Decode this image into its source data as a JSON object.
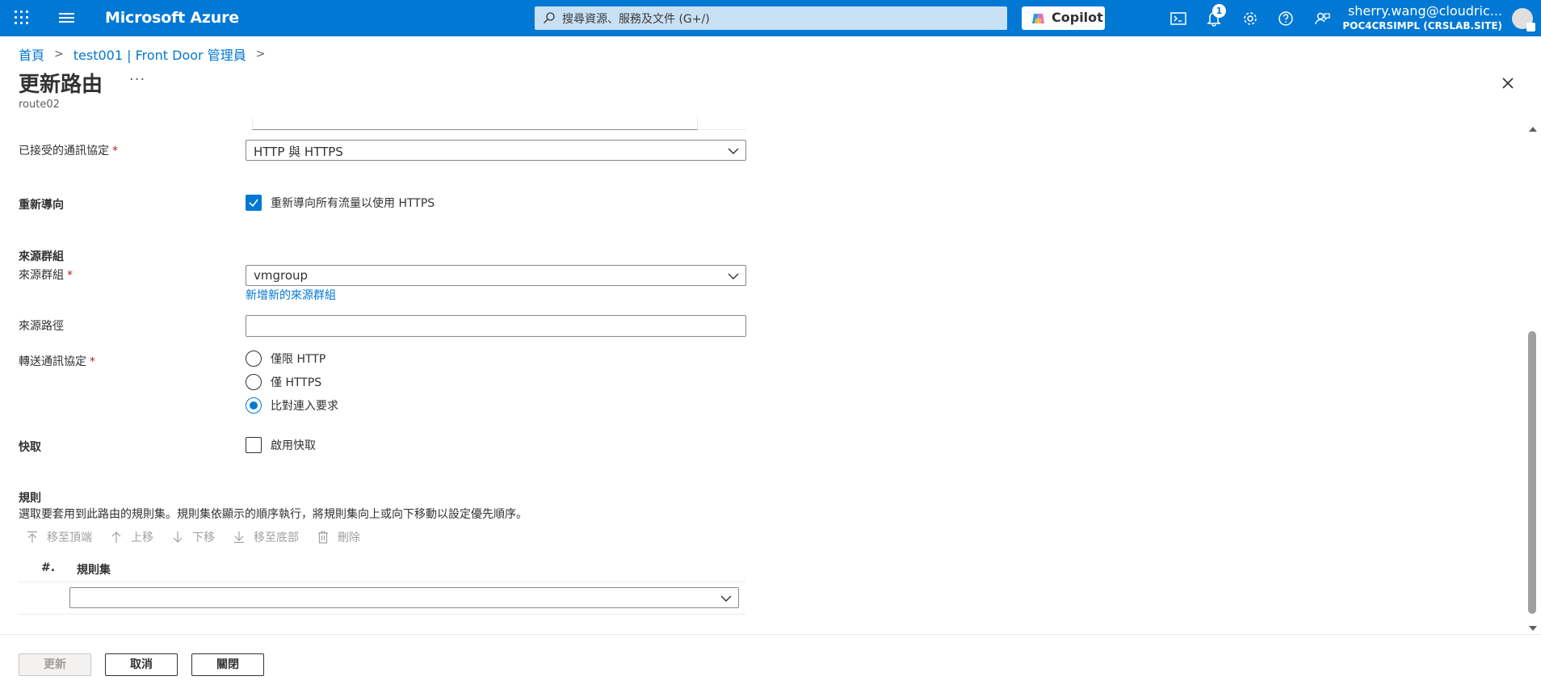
{
  "topbar": {
    "brand": "Microsoft Azure",
    "search_placeholder": "搜尋資源、服務及文件 (G+/)",
    "copilot_label": "Copilot",
    "notification_count": "1",
    "user_name": "sherry.wang@cloudric...",
    "user_tenant": "POC4CRSIMPL (CRSLAB.SITE)"
  },
  "breadcrumb": {
    "items": [
      "首頁",
      "test001 | Front Door 管理員"
    ]
  },
  "header": {
    "title": "更新路由",
    "more": "···",
    "subtitle": "route02"
  },
  "form": {
    "accepted_protocols": {
      "label": "已接受的通訊協定",
      "required": "*",
      "value": "HTTP 與 HTTPS"
    },
    "redirect": {
      "label": "重新導向",
      "checkbox_label": "重新導向所有流量以使用 HTTPS",
      "checked": true
    },
    "origin_group_section": "來源群組",
    "origin_group": {
      "label": "來源群組",
      "required": "*",
      "value": "vmgroup",
      "add_link": "新增新的來源群組"
    },
    "origin_path": {
      "label": "來源路徑",
      "value": ""
    },
    "forwarding_protocol": {
      "label": "轉送通訊協定",
      "required": "*",
      "options": [
        "僅限 HTTP",
        "僅 HTTPS",
        "比對連入要求"
      ],
      "selected": "比對連入要求"
    },
    "caching": {
      "label": "快取",
      "checkbox_label": "啟用快取",
      "checked": false
    },
    "rules": {
      "label": "規則",
      "description": "選取要套用到此路由的規則集。規則集依顯示的順序執行，將規則集向上或向下移動以設定優先順序。",
      "toolbar": {
        "move_top": "移至頂端",
        "move_up": "上移",
        "move_down": "下移",
        "move_bottom": "移至底部",
        "delete": "刪除"
      },
      "columns": {
        "num": "#.",
        "rule_set": "規則集"
      },
      "row_value": ""
    }
  },
  "footer": {
    "update": "更新",
    "cancel": "取消",
    "close": "關閉"
  },
  "colors": {
    "brand": "#0078d4",
    "required": "#a4262c",
    "disabled_text": "#a19f9d"
  }
}
